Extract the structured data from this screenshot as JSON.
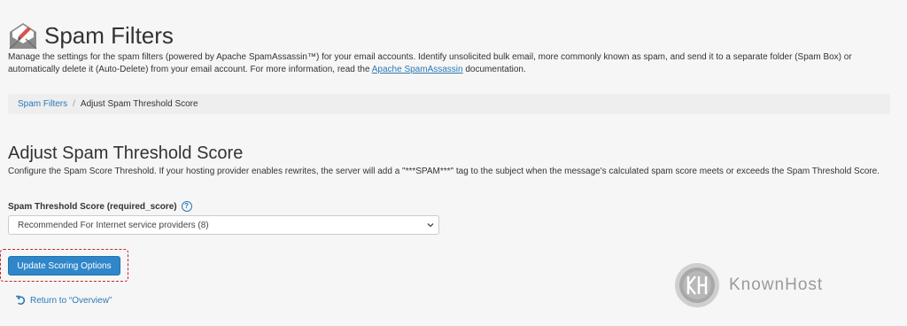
{
  "header": {
    "icon": "mail-filter-icon",
    "title": "Spam Filters"
  },
  "description": {
    "text": "Manage the settings for the spam filters (powered by Apache SpamAssassin™) for your email accounts. Identify unsolicited bulk email, more commonly known as spam, and send it to a separate folder (Spam Box) or automatically delete it (Auto-Delete) from your email account. For more information, read the ",
    "link_text": "Apache SpamAssassin",
    "suffix": " documentation."
  },
  "breadcrumb": {
    "parent": "Spam Filters",
    "separator": "/",
    "current": "Adjust Spam Threshold Score"
  },
  "section": {
    "title": "Adjust Spam Threshold Score",
    "description": "Configure the Spam Score Threshold. If your hosting provider enables rewrites, the server will add a \"***SPAM***\" tag to the subject when the message's calculated spam score meets or exceeds the Spam Threshold Score."
  },
  "field": {
    "label": "Spam Threshold Score (required_score)",
    "help_icon": "?",
    "selected_value": "Recommended For Internet service providers (8)"
  },
  "actions": {
    "update_label": "Update Scoring Options",
    "return_label": "Return to “Overview”"
  },
  "watermark": {
    "text": "KnownHost"
  },
  "colors": {
    "accent": "#2f86c9",
    "link": "#2a7ab7",
    "highlight": "#c0272d"
  }
}
